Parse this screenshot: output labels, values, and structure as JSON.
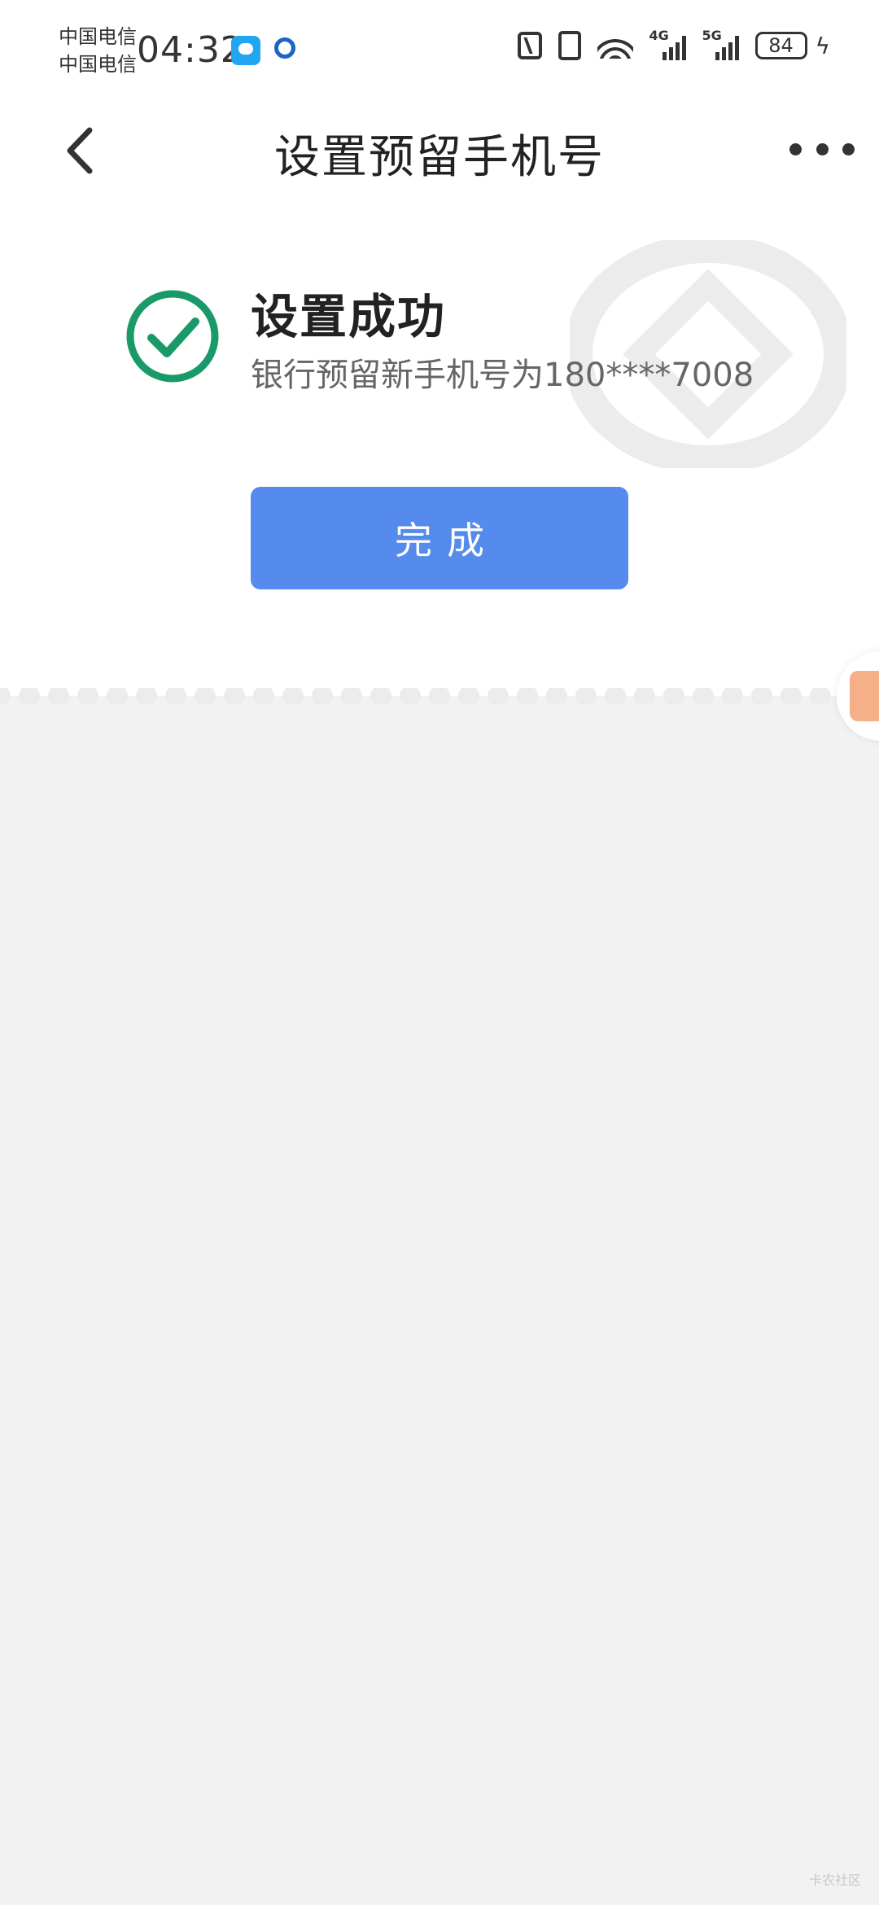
{
  "status_bar": {
    "carrier_1": "中国电信",
    "carrier_2": "中国电信",
    "time": "04:32",
    "signal_1_label": "4G",
    "signal_2_label": "5G",
    "battery": "84",
    "icons": [
      "message-app-icon",
      "ccb-app-icon",
      "nfc-icon",
      "vibrate-icon",
      "wifi-icon",
      "signal-icon",
      "battery-icon",
      "charging-icon"
    ]
  },
  "navbar": {
    "title": "设置预留手机号"
  },
  "result": {
    "title": "设置成功",
    "description": "银行预留新手机号为180****7008",
    "done_label": "完成"
  },
  "colors": {
    "primary_button": "#548bec",
    "success_green": "#1a9a68",
    "page_background": "#f2f2f2"
  },
  "corner_mark": "卡农社区"
}
